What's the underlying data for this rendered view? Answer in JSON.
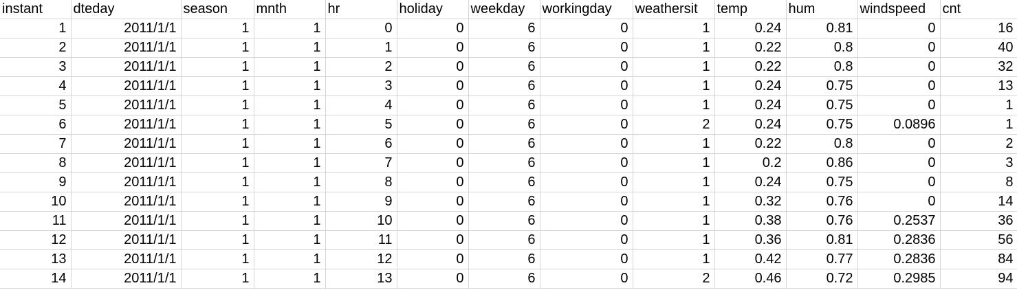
{
  "columns": [
    "instant",
    "dteday",
    "season",
    "mnth",
    "hr",
    "holiday",
    "weekday",
    "workingday",
    "weathersit",
    "temp",
    "hum",
    "windspeed",
    "cnt"
  ],
  "rows": [
    [
      "1",
      "2011/1/1",
      "1",
      "1",
      "0",
      "0",
      "6",
      "0",
      "1",
      "0.24",
      "0.81",
      "0",
      "16"
    ],
    [
      "2",
      "2011/1/1",
      "1",
      "1",
      "1",
      "0",
      "6",
      "0",
      "1",
      "0.22",
      "0.8",
      "0",
      "40"
    ],
    [
      "3",
      "2011/1/1",
      "1",
      "1",
      "2",
      "0",
      "6",
      "0",
      "1",
      "0.22",
      "0.8",
      "0",
      "32"
    ],
    [
      "4",
      "2011/1/1",
      "1",
      "1",
      "3",
      "0",
      "6",
      "0",
      "1",
      "0.24",
      "0.75",
      "0",
      "13"
    ],
    [
      "5",
      "2011/1/1",
      "1",
      "1",
      "4",
      "0",
      "6",
      "0",
      "1",
      "0.24",
      "0.75",
      "0",
      "1"
    ],
    [
      "6",
      "2011/1/1",
      "1",
      "1",
      "5",
      "0",
      "6",
      "0",
      "2",
      "0.24",
      "0.75",
      "0.0896",
      "1"
    ],
    [
      "7",
      "2011/1/1",
      "1",
      "1",
      "6",
      "0",
      "6",
      "0",
      "1",
      "0.22",
      "0.8",
      "0",
      "2"
    ],
    [
      "8",
      "2011/1/1",
      "1",
      "1",
      "7",
      "0",
      "6",
      "0",
      "1",
      "0.2",
      "0.86",
      "0",
      "3"
    ],
    [
      "9",
      "2011/1/1",
      "1",
      "1",
      "8",
      "0",
      "6",
      "0",
      "1",
      "0.24",
      "0.75",
      "0",
      "8"
    ],
    [
      "10",
      "2011/1/1",
      "1",
      "1",
      "9",
      "0",
      "6",
      "0",
      "1",
      "0.32",
      "0.76",
      "0",
      "14"
    ],
    [
      "11",
      "2011/1/1",
      "1",
      "1",
      "10",
      "0",
      "6",
      "0",
      "1",
      "0.38",
      "0.76",
      "0.2537",
      "36"
    ],
    [
      "12",
      "2011/1/1",
      "1",
      "1",
      "11",
      "0",
      "6",
      "0",
      "1",
      "0.36",
      "0.81",
      "0.2836",
      "56"
    ],
    [
      "13",
      "2011/1/1",
      "1",
      "1",
      "12",
      "0",
      "6",
      "0",
      "1",
      "0.42",
      "0.77",
      "0.2836",
      "84"
    ],
    [
      "14",
      "2011/1/1",
      "1",
      "1",
      "13",
      "0",
      "6",
      "0",
      "2",
      "0.46",
      "0.72",
      "0.2985",
      "94"
    ]
  ]
}
